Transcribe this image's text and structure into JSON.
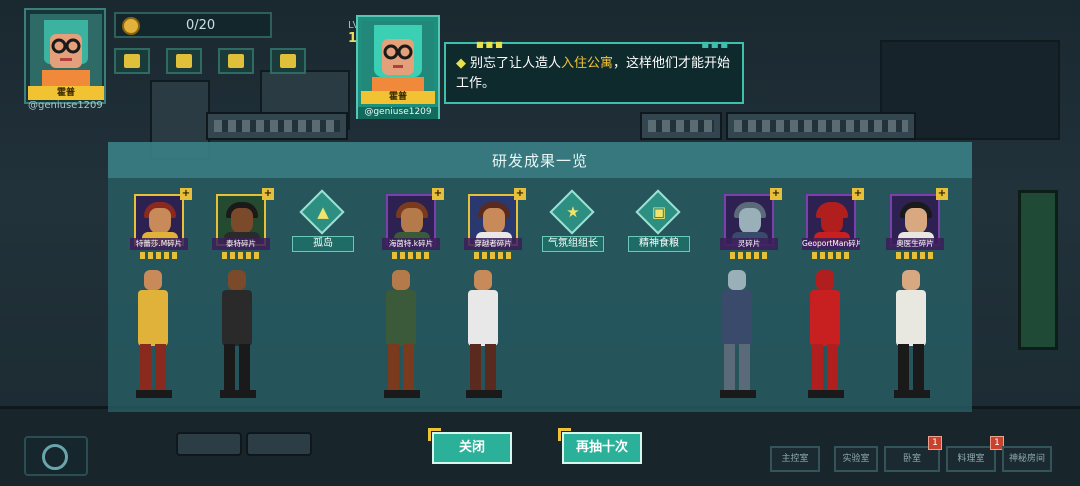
{
  "hud": {
    "player_name": "霍普",
    "player_handle": "@geniuse1209",
    "coins": "0/20",
    "level_label": "LV",
    "level_value": "1"
  },
  "dialog": {
    "speaker_name": "霍普",
    "speaker_handle": "@geniuse1209",
    "text_before": "别忘了让人造人",
    "text_highlight": "入住公寓",
    "text_after": "，这样他们才能开始工作。"
  },
  "panel": {
    "title": "研发成果一览",
    "results": [
      {
        "kind": "character",
        "label": "特蕾莎.M碎片",
        "hair": "#8a2a1e",
        "skin": "#c98a5a",
        "torso": "#e0b23a",
        "bg": "#2c2150",
        "frame": "gold"
      },
      {
        "kind": "character",
        "label": "泰特碎片",
        "hair": "#1a1a1a",
        "skin": "#7a4a2a",
        "torso": "#2a2a2a",
        "bg": "#244a30",
        "frame": "gold"
      },
      {
        "kind": "item",
        "label": "孤岛",
        "glyph": "▲"
      },
      {
        "kind": "character",
        "label": "海茵特.k碎片",
        "hair": "#7a3a1e",
        "skin": "#b57a4a",
        "torso": "#3a5a3a",
        "bg": "#2c2150",
        "frame": "purple"
      },
      {
        "kind": "character",
        "label": "穿越者碎片",
        "hair": "#5a2a1e",
        "skin": "#c98a5a",
        "torso": "#e8e8e8",
        "bg": "#2a3870",
        "frame": "gold"
      },
      {
        "kind": "item",
        "label": "气氛组组长",
        "glyph": "★"
      },
      {
        "kind": "item",
        "label": "精神食粮",
        "glyph": "▣"
      },
      {
        "kind": "character",
        "label": "灵碎片",
        "hair": "#5b6a78",
        "skin": "#9ab0b8",
        "torso": "#3a4a6a",
        "bg": "#2c2150",
        "frame": "purple"
      },
      {
        "kind": "character",
        "label": "GeoportMan碎片",
        "hair": "#b01e1e",
        "skin": "#b01e1e",
        "torso": "#c82020",
        "bg": "#2c2150",
        "frame": "purple"
      },
      {
        "kind": "character",
        "label": "奥医生碎片",
        "hair": "#1a1a1a",
        "skin": "#d8a880",
        "torso": "#e8e8e0",
        "bg": "#2c2150",
        "frame": "purple"
      }
    ]
  },
  "buttons": {
    "close": "关闭",
    "draw_ten": "再抽十次"
  },
  "nav": [
    {
      "label": "主控室"
    },
    {
      "label": "实验室"
    },
    {
      "label": "卧室",
      "alert": "1"
    },
    {
      "label": "料理室",
      "alert": "1"
    },
    {
      "label": "神秘房间"
    }
  ],
  "colors": {
    "accent": "#2bb09a",
    "highlight": "#f0c235",
    "panel": "#286066"
  },
  "icons": {
    "coin": "coin-icon",
    "refresh": "refresh-icon"
  }
}
